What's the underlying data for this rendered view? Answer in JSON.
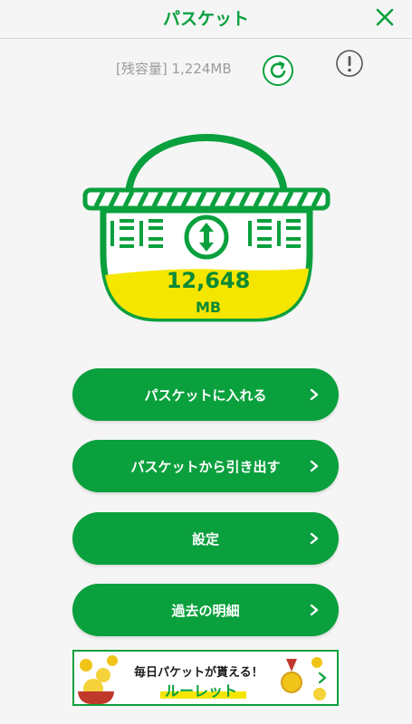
{
  "header": {
    "title": "パスケット",
    "close_icon": "close-icon"
  },
  "capacity": {
    "text": "[残容量] 1,224MB",
    "refresh_icon": "refresh-icon",
    "info_icon": "info-icon"
  },
  "basket": {
    "value": "12,648",
    "unit": "MB",
    "transfer_icon": "up-down-arrows-icon",
    "fill_level": 0.3
  },
  "buttons": [
    {
      "label": "パスケットに入れる"
    },
    {
      "label": "パスケットから引き出す"
    },
    {
      "label": "設定"
    },
    {
      "label": "過去の明細"
    }
  ],
  "banner": {
    "line1": "毎日パケットが貰える！",
    "line2": "ルーレット"
  },
  "colors": {
    "accent": "#0aa03d",
    "fill": "#f5e600",
    "text_gray": "#9b9b9b"
  }
}
